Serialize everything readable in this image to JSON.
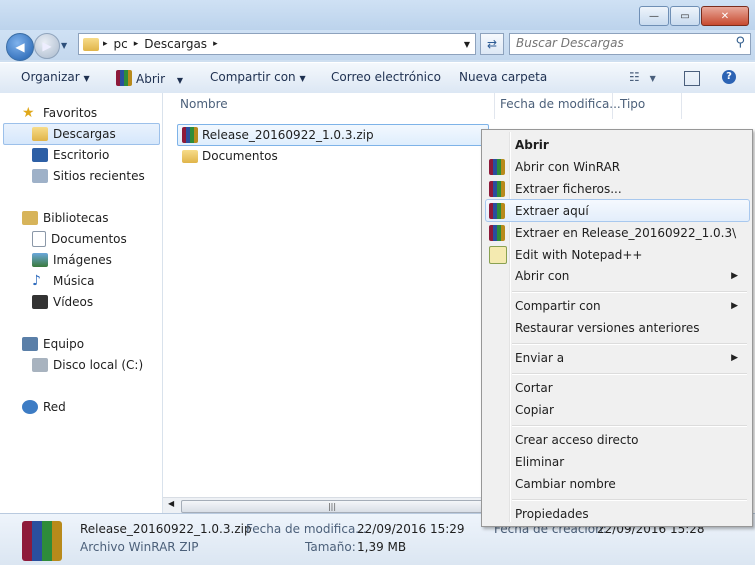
{
  "window": {
    "min": "—",
    "max": "▭",
    "close": "✕"
  },
  "address": {
    "parts": [
      "pc",
      "Descargas"
    ],
    "sep": "▸"
  },
  "search": {
    "placeholder": "Buscar Descargas"
  },
  "toolbar": {
    "organize": "Organizar",
    "open": "Abrir",
    "share": "Compartir con",
    "email": "Correo electrónico",
    "newfolder": "Nueva carpeta"
  },
  "nav": {
    "favorites": "Favoritos",
    "downloads": "Descargas",
    "desktop": "Escritorio",
    "recent": "Sitios recientes",
    "libraries": "Bibliotecas",
    "docs": "Documentos",
    "images": "Imágenes",
    "music": "Música",
    "videos": "Vídeos",
    "computer": "Equipo",
    "localdisk": "Disco local (C:)",
    "network": "Red"
  },
  "columns": {
    "name": "Nombre",
    "date": "Fecha de modifica...",
    "type": "Tipo"
  },
  "files": [
    {
      "name": "Release_20160922_1.0.3.zip"
    },
    {
      "name": "Documentos"
    }
  ],
  "details": {
    "name": "Release_20160922_1.0.3.zip",
    "type": "Archivo WinRAR ZIP",
    "mod_label": "Fecha de modifica...",
    "mod_value": "22/09/2016 15:29",
    "size_label": "Tamaño:",
    "size_value": "1,39 MB",
    "created_label": "Fecha de creación:",
    "created_value": "22/09/2016 15:28"
  },
  "menu": {
    "open": "Abrir",
    "open_winrar": "Abrir con WinRAR",
    "extract_files": "Extraer ficheros...",
    "extract_here": "Extraer aquí",
    "extract_to": "Extraer en Release_20160922_1.0.3\\",
    "notepad": "Edit with Notepad++",
    "open_with": "Abrir con",
    "share": "Compartir con",
    "restore": "Restaurar versiones anteriores",
    "send_to": "Enviar a",
    "cut": "Cortar",
    "copy": "Copiar",
    "shortcut": "Crear acceso directo",
    "delete": "Eliminar",
    "rename": "Cambiar nombre",
    "properties": "Propiedades"
  }
}
